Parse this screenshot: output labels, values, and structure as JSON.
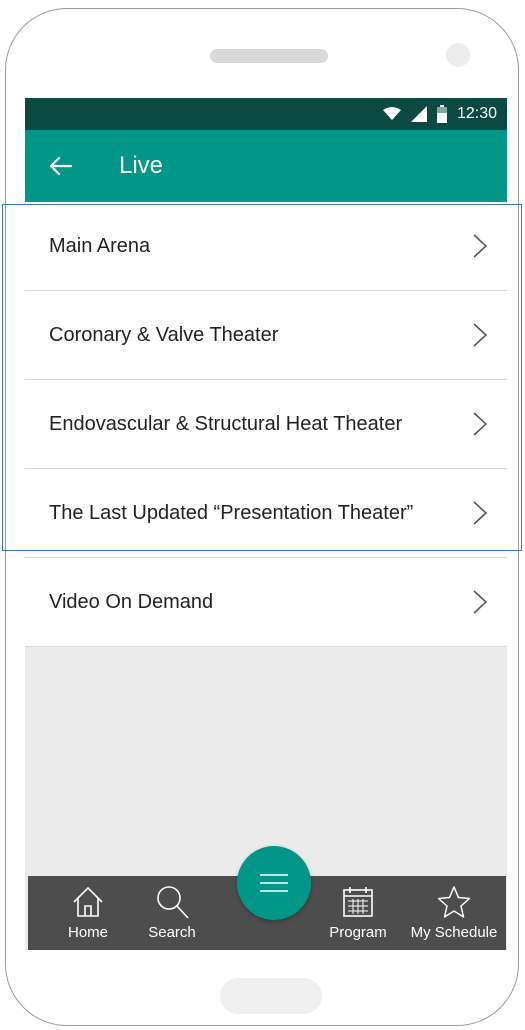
{
  "status": {
    "time": "12:30"
  },
  "appbar": {
    "title": "Live"
  },
  "list": {
    "items": [
      {
        "label": "Main Arena"
      },
      {
        "label": "Coronary & Valve Theater"
      },
      {
        "label": "Endovascular & Structural Heat Theater"
      },
      {
        "label": "The Last Updated “Presentation Theater”"
      },
      {
        "label": "Video On Demand"
      }
    ]
  },
  "nav": {
    "home": "Home",
    "search": "Search",
    "program": "Program",
    "schedule": "My Schedule"
  },
  "colors": {
    "primary": "#009688",
    "status_bar": "#0b4a40",
    "bottom_bar": "#4d4d4d",
    "selection": "#3b73c7"
  },
  "icons": [
    "back-arrow-icon",
    "chevron-right-icon",
    "home-icon",
    "search-icon",
    "menu-icon",
    "calendar-icon",
    "star-icon",
    "wifi-icon",
    "signal-icon",
    "battery-icon"
  ]
}
